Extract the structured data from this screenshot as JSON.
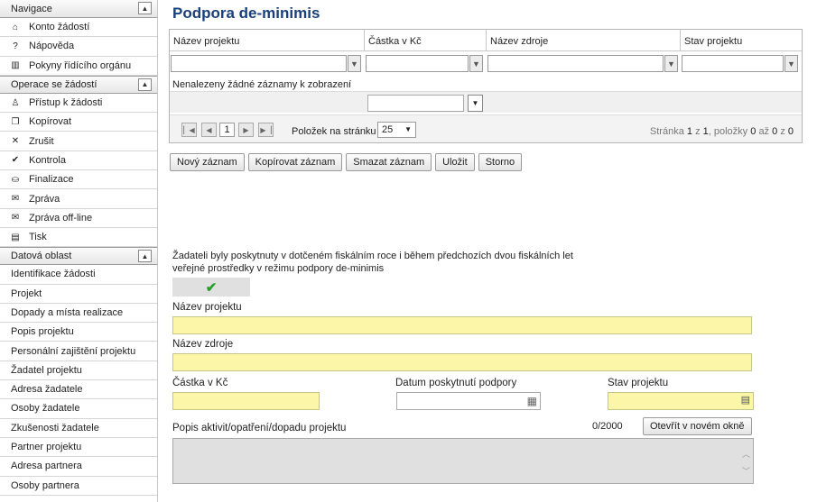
{
  "sidebar": {
    "nav_title": "Navigace",
    "nav_items": [
      {
        "icon": "home-icon",
        "glyph": "⌂",
        "label": "Konto žádostí"
      },
      {
        "icon": "help-icon",
        "glyph": "?",
        "label": "Nápověda"
      },
      {
        "icon": "book-icon",
        "glyph": "▥",
        "label": "Pokyny řídícího orgánu"
      }
    ],
    "ops_title": "Operace se žádostí",
    "ops_items": [
      {
        "icon": "user-access-icon",
        "glyph": "♙",
        "label": "Přístup k žádosti"
      },
      {
        "icon": "copy-icon",
        "glyph": "❐",
        "label": "Kopírovat"
      },
      {
        "icon": "cross-icon",
        "glyph": "✕",
        "label": "Zrušit"
      },
      {
        "icon": "check-icon",
        "glyph": "✔",
        "label": "Kontrola"
      },
      {
        "icon": "lock-icon",
        "glyph": "⛀",
        "label": "Finalizace"
      },
      {
        "icon": "mail-icon",
        "glyph": "✉",
        "label": "Zpráva"
      },
      {
        "icon": "mail-offline-icon",
        "glyph": "✉",
        "label": "Zpráva off-line"
      },
      {
        "icon": "print-icon",
        "glyph": "▤",
        "label": "Tisk"
      }
    ],
    "data_title": "Datová oblast",
    "data_items": [
      "Identifikace žádosti",
      "Projekt",
      "Dopady a místa realizace",
      "Popis projektu",
      "Personální zajištění projektu",
      "Žadatel projektu",
      "Adresa žadatele",
      "Osoby žadatele",
      "Zkušenosti žadatele",
      "Partner projektu",
      "Adresa partnera",
      "Osoby partnera"
    ],
    "toggle_glyph": "▲"
  },
  "page_title": "Podpora de-minimis",
  "grid": {
    "columns": [
      "Název projektu",
      "Částka v Kč",
      "Název zdroje",
      "Stav projektu"
    ],
    "filter_glyph": "▼",
    "empty_message": "Nenalezeny žádné záznamy k zobrazení",
    "current_page": "1",
    "per_page_label": "Položek na stránku",
    "per_page_value": "25",
    "info": {
      "prefix": "Stránka",
      "page": "1",
      "of_word": "z",
      "pages": "1",
      "items_word": ", položky",
      "from": "0",
      "to_word": "až",
      "to": "0",
      "z2": "z",
      "total": "0"
    }
  },
  "buttons": {
    "new": "Nový záznam",
    "copy": "Kopírovat záznam",
    "delete": "Smazat záznam",
    "save": "Uložit",
    "cancel": "Storno"
  },
  "form": {
    "question": "Žadateli byly poskytnuty v dotčeném fiskálním roce i během předchozích dvou fiskálních let veřejné prostředky v režimu podpory de-minimis",
    "question_checked_glyph": "✔",
    "project_name_label": "Název projektu",
    "project_name_value": "",
    "source_name_label": "Název zdroje",
    "source_name_value": "",
    "amount_label": "Částka v Kč",
    "amount_value": "",
    "date_label": "Datum poskytnutí podpory",
    "date_value": "",
    "state_label": "Stav projektu",
    "state_value": "",
    "description_label": "Popis aktivit/opatření/dopadu projektu",
    "description_counter": "0/2000",
    "open_new_window": "Otevřít v novém okně",
    "description_value": ""
  },
  "colors": {
    "title": "#1a3f7a",
    "required_field": "#fcf6a8",
    "check": "#2aa02a"
  }
}
